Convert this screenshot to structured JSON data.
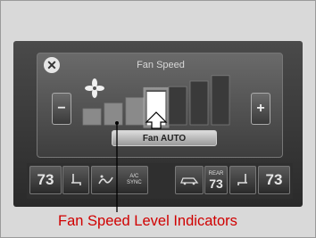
{
  "panel": {
    "title": "Fan Speed",
    "close_symbol": "✕",
    "minus_label": "−",
    "plus_label": "+",
    "fan_auto_label": "Fan AUTO",
    "fan_level": 4,
    "fan_levels_total": 7,
    "icons": {
      "close": "close-icon",
      "fan": "fan-icon",
      "pointer": "up-arrow-icon"
    }
  },
  "bottom_bar": {
    "left_temp": "73",
    "right_temp": "73",
    "ac_label": "A/C",
    "sync_label": "SYNC",
    "rear_label": "REAR",
    "rear_temp": "73"
  },
  "caption": "Fan Speed Level Indicators",
  "colors": {
    "caption": "#d00000",
    "active_bar": "#ffffff"
  }
}
